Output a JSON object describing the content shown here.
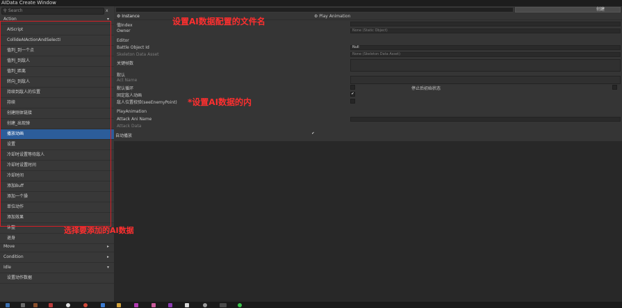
{
  "window": {
    "title": "AIData Create Window"
  },
  "search": {
    "placeholder": "Search",
    "close": "x"
  },
  "tree": {
    "action_label": "Action",
    "items": [
      "AIScript",
      "CollideAIActionAndSelectI",
      "值判_到一个点",
      "值判_到敌人",
      "值判_距离",
      "转向_到敌人",
      "持续到敌人的位置",
      "持续",
      "创建刚体链接",
      "创建_出现弹",
      "播放动画",
      "设置",
      "冷却时设置等待敌人",
      "冷却时设置时间",
      "冷却时间",
      "添加Buff",
      "添加一个操",
      "单位动作",
      "添加效果",
      "休整",
      "退身"
    ],
    "selected_index": 10,
    "move_label": "Move",
    "condition_label": "Condition",
    "idle_label": "Idle",
    "footer_item": "设置动作数据"
  },
  "toolbar": {
    "title_placeholder": "",
    "right_button": "创建"
  },
  "inspector": {
    "instance_title": "Instance",
    "id_label": "值Index",
    "owner_label": "Owner",
    "editor_heading": "Editor",
    "battle_object_label": "Battle Object Id",
    "skeleton_label": "Skeleton Data Asset",
    "frame_label": "关键帧数",
    "default_heading": "默认",
    "act_name_label": "Act Name",
    "flag1_label": "默认循环",
    "flag2_label": "固定敌人动画",
    "flag3_label": "敌人位置校验(seeEnemyPoint)",
    "play_heading": "PlayAnimation",
    "attack_anim_label": "Attack Ani Name",
    "attack_data_label": "Attack Data",
    "auto_loop_label": "自动播放",
    "play_anim_title": "Play Animation",
    "owner_value": "None (Static Object)",
    "battle_object_value": "Null",
    "skeleton_value": "None (Skeleton Data Asset)",
    "right_note": "停止后初始状态",
    "check1": "",
    "check2": "✔",
    "check3": "",
    "auto_loop_check": "✔"
  },
  "annotations": {
    "note1": "设置AI数据配置的文件名",
    "note2": "*设置AI数据的内",
    "note3": "选择要添加的AI数据"
  },
  "colors": {
    "selected": "#2c5d9a",
    "annotation": "#ff2f2f"
  }
}
